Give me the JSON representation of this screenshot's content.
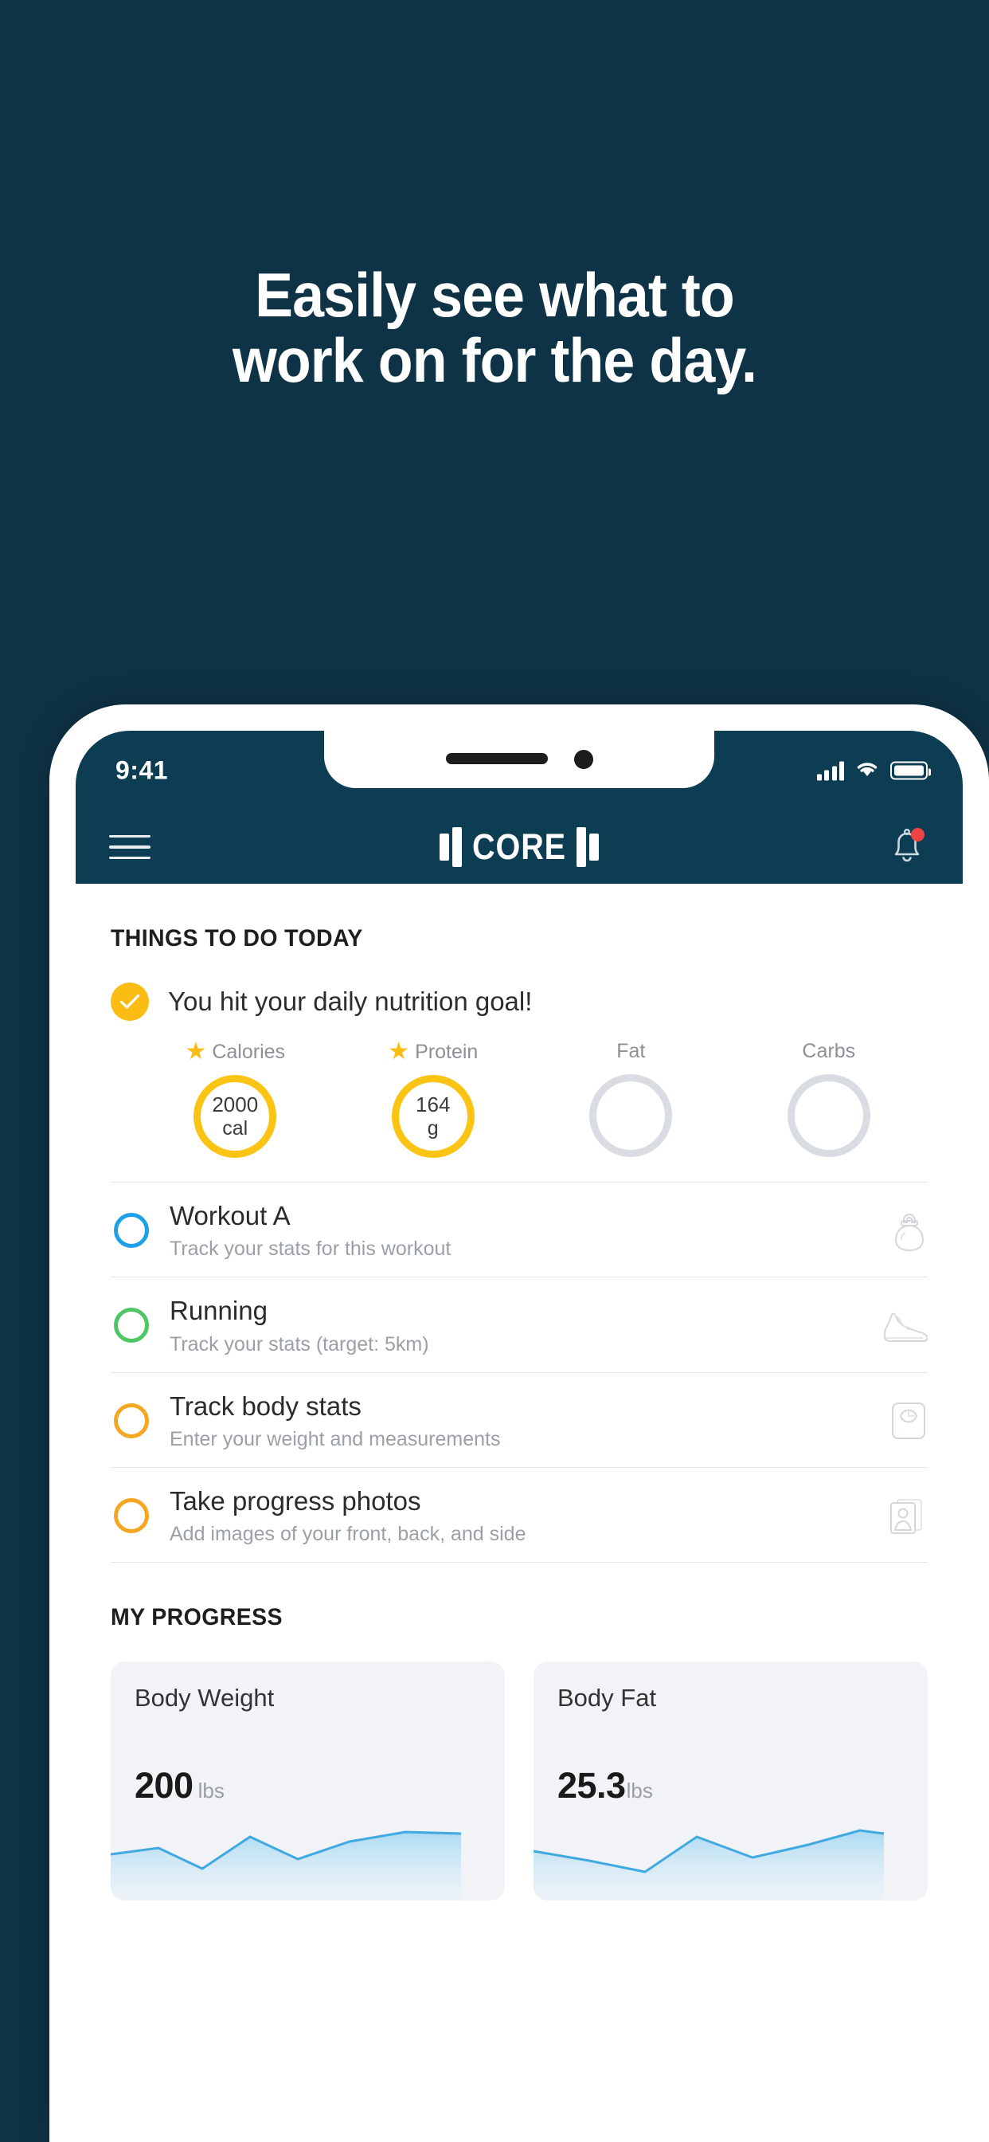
{
  "theme": {
    "background": "#0f3346",
    "header_bg": "#0c3d52",
    "accent_yellow": "#fbbd14",
    "accent_blue": "#1ca0e8",
    "accent_green": "#4cc764",
    "accent_orange": "#f5a623",
    "badge_red": "#ef4444",
    "spark_blue": "#4db6e8"
  },
  "headline": {
    "line1": "Easily see what to",
    "line2": "work on for the day."
  },
  "status_bar": {
    "time": "9:41",
    "signal_icon": "cellular-signal-icon",
    "wifi_icon": "wifi-icon",
    "battery_icon": "battery-icon"
  },
  "app_header": {
    "menu_icon": "hamburger-menu-icon",
    "logo_text": "CORE",
    "logo_icon": "dumbbell-icon",
    "bell_icon": "notification-bell-icon",
    "has_notification": true
  },
  "todo": {
    "section_title": "THINGS TO DO TODAY",
    "nutrition": {
      "check_icon": "check-circle-icon",
      "message": "You hit your daily nutrition goal!",
      "macros": [
        {
          "label": "Calories",
          "starred": true,
          "value": "2000",
          "unit": "cal",
          "complete": true
        },
        {
          "label": "Protein",
          "starred": true,
          "value": "164",
          "unit": "g",
          "complete": true
        },
        {
          "label": "Fat",
          "starred": false,
          "value": "",
          "unit": "",
          "complete": false
        },
        {
          "label": "Carbs",
          "starred": false,
          "value": "",
          "unit": "",
          "complete": false
        }
      ]
    },
    "tasks": [
      {
        "title": "Workout A",
        "subtitle": "Track your stats for this workout",
        "circle_color": "#1ca0e8",
        "icon": "kettlebell-icon"
      },
      {
        "title": "Running",
        "subtitle": "Track your stats (target: 5km)",
        "circle_color": "#4cc764",
        "icon": "running-shoe-icon"
      },
      {
        "title": "Track body stats",
        "subtitle": "Enter your weight and measurements",
        "circle_color": "#f5a623",
        "icon": "weight-scale-icon"
      },
      {
        "title": "Take progress photos",
        "subtitle": "Add images of your front, back, and side",
        "circle_color": "#f5a623",
        "icon": "progress-photo-icon"
      }
    ]
  },
  "progress": {
    "section_title": "MY PROGRESS",
    "cards": [
      {
        "title": "Body Weight",
        "value": "200",
        "unit": "lbs"
      },
      {
        "title": "Body Fat",
        "value": "25.3",
        "unit": "lbs"
      }
    ]
  }
}
